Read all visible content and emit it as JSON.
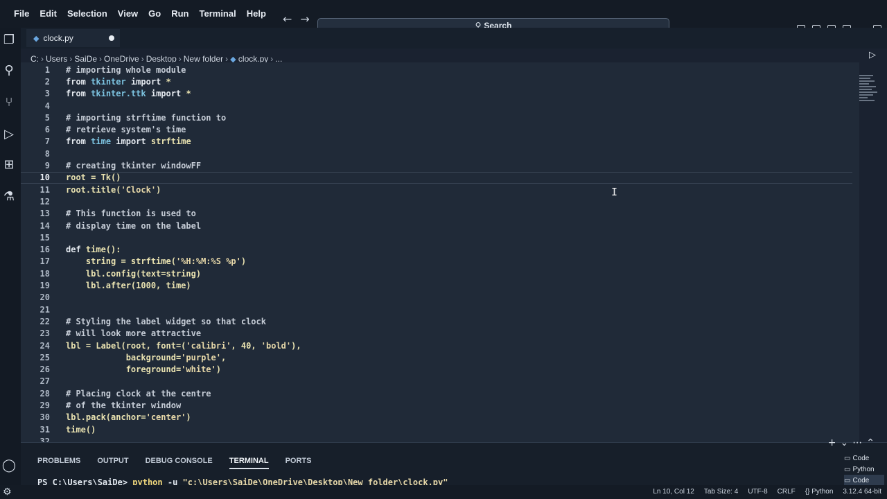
{
  "menu": [
    "File",
    "Edit",
    "Selection",
    "View",
    "Go",
    "Run",
    "Terminal",
    "Help"
  ],
  "search": {
    "label": "Search"
  },
  "tab": {
    "name": "clock.py"
  },
  "breadcrumb": [
    "C:",
    "Users",
    "SaiDe",
    "OneDrive",
    "Desktop",
    "New folder",
    "clock.py",
    "..."
  ],
  "editor": {
    "lines": [
      {
        "n": "1",
        "text": "# importing whole module"
      },
      {
        "n": "2",
        "text": "from tkinter import *"
      },
      {
        "n": "3",
        "text": "from tkinter.ttk import *"
      },
      {
        "n": "4",
        "text": ""
      },
      {
        "n": "5",
        "text": "# importing strftime function to"
      },
      {
        "n": "6",
        "text": "# retrieve system's time"
      },
      {
        "n": "7",
        "text": "from time import strftime"
      },
      {
        "n": "8",
        "text": ""
      },
      {
        "n": "9",
        "text": "# creating tkinter windowFF"
      },
      {
        "n": "10",
        "text": "root = Tk()"
      },
      {
        "n": "11",
        "text": "root.title('Clock')"
      },
      {
        "n": "12",
        "text": ""
      },
      {
        "n": "13",
        "text": "# This function is used to"
      },
      {
        "n": "14",
        "text": "# display time on the label"
      },
      {
        "n": "15",
        "text": ""
      },
      {
        "n": "16",
        "text": "def time():"
      },
      {
        "n": "17",
        "text": "    string = strftime('%H:%M:%S %p')"
      },
      {
        "n": "18",
        "text": "    lbl.config(text=string)"
      },
      {
        "n": "19",
        "text": "    lbl.after(1000, time)"
      },
      {
        "n": "20",
        "text": ""
      },
      {
        "n": "21",
        "text": ""
      },
      {
        "n": "22",
        "text": "# Styling the label widget so that clock"
      },
      {
        "n": "23",
        "text": "# will look more attractive"
      },
      {
        "n": "24",
        "text": "lbl = Label(root, font=('calibri', 40, 'bold'),"
      },
      {
        "n": "25",
        "text": "            background='purple',"
      },
      {
        "n": "26",
        "text": "            foreground='white')"
      },
      {
        "n": "27",
        "text": ""
      },
      {
        "n": "28",
        "text": "# Placing clock at the centre"
      },
      {
        "n": "29",
        "text": "# of the tkinter window"
      },
      {
        "n": "30",
        "text": "lbl.pack(anchor='center')"
      },
      {
        "n": "31",
        "text": "time()"
      },
      {
        "n": "32",
        "text": ""
      }
    ],
    "active_line": "10"
  },
  "panel": {
    "tabs": [
      "PROBLEMS",
      "OUTPUT",
      "DEBUG CONSOLE",
      "TERMINAL",
      "PORTS"
    ],
    "active_tab": "TERMINAL",
    "prompt": "PS C:\\Users\\SaiDe>",
    "command": "python",
    "args": " -u ",
    "path": "\"c:\\Users\\SaiDe\\OneDrive\\Desktop\\New folder\\clock.py\"",
    "terminals": [
      "Code",
      "Python",
      "Code"
    ]
  },
  "status": {
    "position": "Ln 10, Col 12",
    "tab_size": "Tab Size: 4",
    "encoding": "UTF-8",
    "eol": "CRLF",
    "language": "Python",
    "interpreter": "3.12.4 64-bit"
  },
  "colors": {
    "accent": "#6aa7e0",
    "editor_bg": "#202a38"
  }
}
